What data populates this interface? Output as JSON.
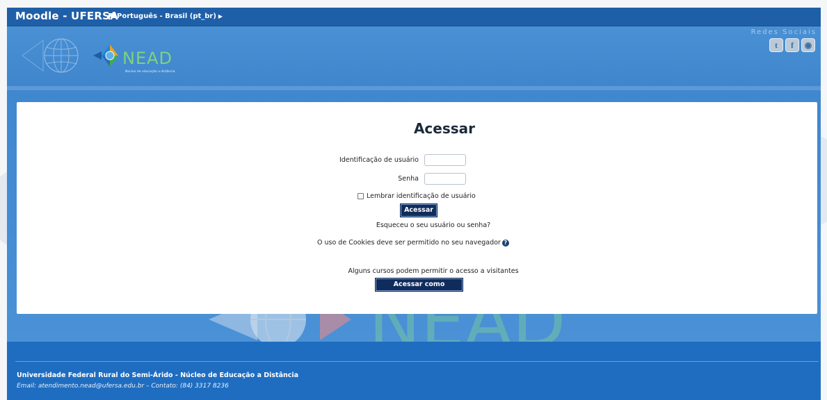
{
  "navbar": {
    "brand": "Moodle - UFERSA",
    "language": "Português - Brasil (pt_br)"
  },
  "header": {
    "logo_text": "NEAD",
    "logo_subtitle": "Núcleo de educação a distância",
    "social_title": "Redes Sociais",
    "social": [
      {
        "name": "twitter-icon",
        "glyph": "t"
      },
      {
        "name": "facebook-icon",
        "glyph": "f"
      },
      {
        "name": "other-social-icon",
        "glyph": "◉"
      }
    ]
  },
  "login": {
    "title": "Acessar",
    "username_label": "Identificação de usuário",
    "username_value": "",
    "password_label": "Senha",
    "password_value": "",
    "remember_label": "Lembrar identificação de usuário",
    "submit_label": "Acessar",
    "forgot_link": "Esqueceu o seu usuário ou senha?",
    "cookies_text": "O uso de Cookies deve ser permitido no seu navegador",
    "guest_text": "Alguns cursos podem permitir o acesso a visitantes",
    "guest_button": "Acessar como visitante"
  },
  "footer": {
    "title": "Universidade Federal Rural do Semi-Árido - Núcleo de Educação a Distância",
    "contact": "Email: atendimento.nead@ufersa.edu.br – Contato: (84)  3317 8236"
  },
  "colors": {
    "navbar": "#1f5fa8",
    "header": "#4a90d4",
    "button": "#102c5c",
    "footer": "#1f6dc0"
  }
}
